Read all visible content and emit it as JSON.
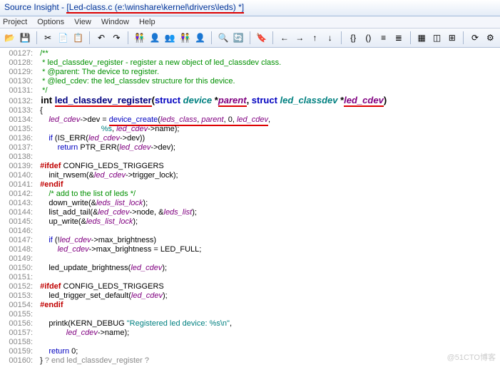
{
  "title_prefix": "Source Insight - ",
  "title_file": "[Led-class.c (e:\\winshare\\kernel\\drivers\\leds) *]",
  "menu": [
    "Project",
    "Options",
    "View",
    "Window",
    "Help"
  ],
  "toolbar_icons": [
    "open",
    "save",
    "sep",
    "cut",
    "copy",
    "paste",
    "sep",
    "undo",
    "redo",
    "sep",
    "nav1",
    "nav2",
    "nav3",
    "nav4",
    "nav5",
    "sep",
    "find",
    "replace",
    "sep",
    "bookmark",
    "sep",
    "back",
    "fwd",
    "up",
    "down",
    "sep",
    "sym1",
    "sym2",
    "sym3",
    "sym4",
    "sep",
    "win1",
    "win2",
    "win3",
    "sep",
    "sync",
    "cfg"
  ],
  "glyphs": {
    "open": "📂",
    "save": "💾",
    "cut": "✂",
    "copy": "📄",
    "paste": "📋",
    "undo": "↶",
    "redo": "↷",
    "nav1": "👫",
    "nav2": "👤",
    "nav3": "👥",
    "nav4": "👫",
    "nav5": "👤",
    "find": "🔍",
    "replace": "🔄",
    "bookmark": "🔖",
    "back": "←",
    "fwd": "→",
    "up": "↑",
    "down": "↓",
    "sym1": "{}",
    "sym2": "()",
    "sym3": "≡",
    "sym4": "≣",
    "win1": "▦",
    "win2": "◫",
    "win3": "⊞",
    "sync": "⟳",
    "cfg": "⚙"
  },
  "lines": [
    {
      "n": "00127",
      "cls": "cmt",
      "t": "  /**"
    },
    {
      "n": "00128",
      "cls": "cmt",
      "t": "   * led_classdev_register - register a new object of led_classdev class."
    },
    {
      "n": "00129",
      "cls": "cmt",
      "t": "   * @parent: The device to register."
    },
    {
      "n": "00130",
      "cls": "cmt",
      "t": "   * @led_cdev: the led_classdev structure for this device."
    },
    {
      "n": "00131",
      "cls": "cmt",
      "t": "   */"
    }
  ],
  "decl": {
    "n": "00132",
    "ret": "int ",
    "fn": "led_classdev_register",
    "open": "(",
    "p1_kw": "struct ",
    "p1_ty": "device",
    "p1_star": " *",
    "p1_id": "parent",
    "comma": ", ",
    "p2_kw": "struct ",
    "p2_ty": "led_classdev",
    "p2_star": " *",
    "p2_id": "led_cdev",
    "close": ")"
  },
  "brace_open": {
    "n": "00133",
    "t": "  {"
  },
  "create": {
    "n": "00134",
    "pre": "      ",
    "lhs_id": "led_cdev",
    "lhs_rest": "->dev = ",
    "fn": "device_create",
    "open": "(",
    "a1": "leds_class",
    "c1": ", ",
    "a2": "parent",
    "c2": ", ",
    "a3": "0",
    "c3": ", ",
    "a4": "led_cdev",
    "tail": ","
  },
  "create2": {
    "n": "00135",
    "pre": "                              ",
    "fmt": "%s",
    "c": ", ",
    "id": "led_cdev",
    "rest": "->name);"
  },
  "rest": [
    {
      "n": "00136",
      "html": "      <span class='kw'>if</span> (IS_ERR(<span class='id'>led_cdev</span>->dev))"
    },
    {
      "n": "00137",
      "html": "          <span class='kw'>return</span> PTR_ERR(<span class='id'>led_cdev</span>->dev);"
    },
    {
      "n": "00138",
      "html": ""
    },
    {
      "n": "00139",
      "html": "  <span class='pp'>#ifdef</span> CONFIG_LEDS_TRIGGERS"
    },
    {
      "n": "00140",
      "html": "      init_rwsem(&<span class='id'>led_cdev</span>->trigger_lock);"
    },
    {
      "n": "00141",
      "html": "  <span class='pp'>#endif</span>"
    },
    {
      "n": "00142",
      "html": "      <span class='cmt'>/* add to the list of leds */</span>"
    },
    {
      "n": "00143",
      "html": "      down_write(&<span class='id'>leds_list_lock</span>);"
    },
    {
      "n": "00144",
      "html": "      list_add_tail(&<span class='id'>led_cdev</span>->node, &<span class='id'>leds_list</span>);"
    },
    {
      "n": "00145",
      "html": "      up_write(&<span class='id'>leds_list_lock</span>);"
    },
    {
      "n": "00146",
      "html": ""
    },
    {
      "n": "00147",
      "html": "      <span class='kw'>if</span> (!<span class='id'>led_cdev</span>->max_brightness)"
    },
    {
      "n": "00148",
      "html": "          <span class='id'>led_cdev</span>->max_brightness = LED_FULL;"
    },
    {
      "n": "00149",
      "html": ""
    },
    {
      "n": "00150",
      "html": "      led_update_brightness(<span class='id'>led_cdev</span>);"
    },
    {
      "n": "00151",
      "html": ""
    },
    {
      "n": "00152",
      "html": "  <span class='pp'>#ifdef</span> CONFIG_LEDS_TRIGGERS"
    },
    {
      "n": "00153",
      "html": "      led_trigger_set_default(<span class='id'>led_cdev</span>);"
    },
    {
      "n": "00154",
      "html": "  <span class='pp'>#endif</span>"
    },
    {
      "n": "00155",
      "html": ""
    },
    {
      "n": "00156",
      "html": "      printk(KERN_DEBUG <span class='str'>\"Registered led device: %s\\n\"</span>,"
    },
    {
      "n": "00157",
      "html": "              <span class='id'>led_cdev</span>->name);"
    },
    {
      "n": "00158",
      "html": ""
    },
    {
      "n": "00159",
      "html": "      <span class='kw'>return</span> 0;"
    },
    {
      "n": "00160",
      "html": "  } <span class='cmt-gray'>? end led_classdev_register ?</span>"
    }
  ],
  "watermark": "@51CTO博客"
}
